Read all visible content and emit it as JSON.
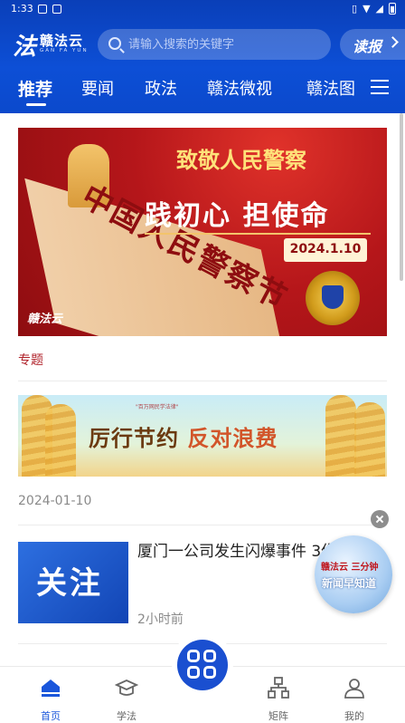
{
  "status_bar": {
    "time": "1:33"
  },
  "header": {
    "logo_text": "赣法云",
    "logo_sub": "GAN FA YUN",
    "search_placeholder": "请输入搜索的关键字",
    "read_button": "读报"
  },
  "tabs": [
    {
      "label": "推荐",
      "active": true
    },
    {
      "label": "要闻"
    },
    {
      "label": "政法"
    },
    {
      "label": "赣法微视"
    },
    {
      "label": "赣法图"
    }
  ],
  "banner": {
    "title_line1": "致敬人民警察",
    "title_line2": "践初心 担使命",
    "date": "2024.1.10",
    "road_text": "中国人民警察节",
    "watermark": "赣法云"
  },
  "section": {
    "label": "专题"
  },
  "banner2": {
    "subtitle": "\"百万网民学法律\"",
    "title_a": "厉行节约",
    "title_b": "反对浪费"
  },
  "news_date": "2024-01-10",
  "news_item": {
    "thumb_text": "关注",
    "title": "厦门一公司发生闪爆事件 3伤",
    "time": "2小时前"
  },
  "floating_ad": {
    "line1": "赣法云 三分钟",
    "line2": "新闻早知道"
  },
  "bottom_nav": [
    {
      "label": "首页",
      "active": true,
      "icon": "home-icon"
    },
    {
      "label": "学法",
      "icon": "graduation-cap-icon"
    },
    {
      "label": "",
      "icon": "apps-grid-icon"
    },
    {
      "label": "矩阵",
      "icon": "org-tree-icon"
    },
    {
      "label": "我的",
      "icon": "user-icon"
    }
  ],
  "colors": {
    "primary": "#0d4fd6",
    "accent_red": "#b0222a"
  }
}
